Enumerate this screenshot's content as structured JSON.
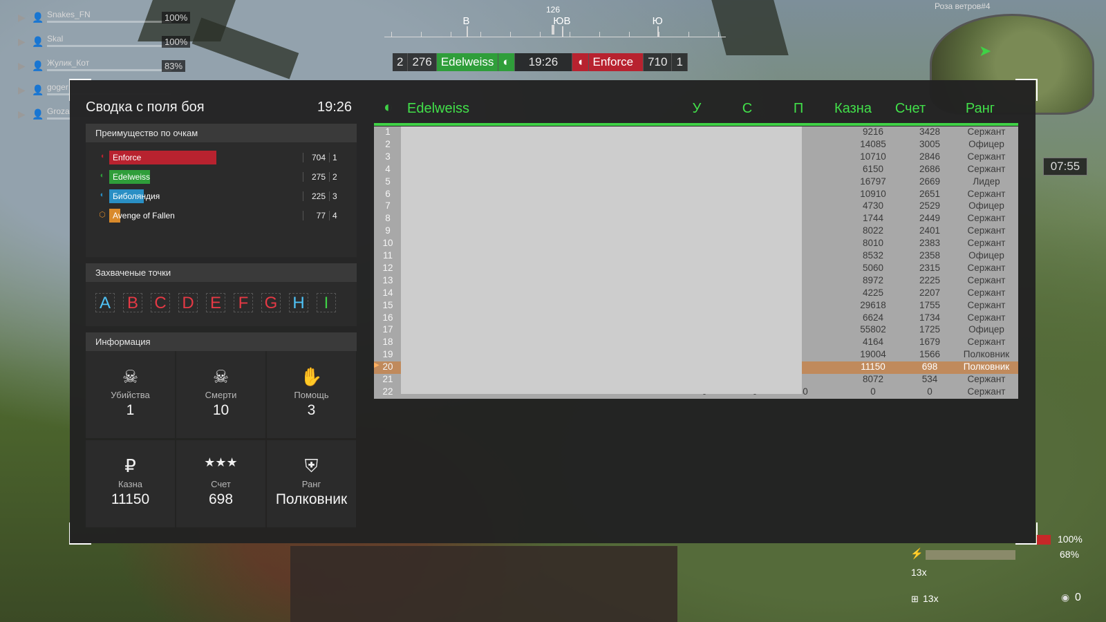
{
  "compass": {
    "heading": "126",
    "labels": [
      {
        "text": "В",
        "pos": 0.24
      },
      {
        "text": "ЮВ",
        "pos": 0.52
      },
      {
        "text": "Ю",
        "pos": 0.8
      }
    ]
  },
  "topscore": {
    "left_place": "2",
    "left_score": "276",
    "left_team": "Edelweiss",
    "time": "19:26",
    "right_team": "Enforce",
    "right_score": "710",
    "right_place": "1"
  },
  "squad": [
    {
      "name": "Snakes_FN",
      "pct": "100%"
    },
    {
      "name": "Skal",
      "pct": "100%"
    },
    {
      "name": "Жулик_Кот",
      "pct": "83%"
    },
    {
      "name": "goger",
      "pct": ""
    },
    {
      "name": "Groza",
      "pct": ""
    }
  ],
  "minimap": {
    "name": "Роза ветров#4",
    "time": "07:55"
  },
  "summary": {
    "title": "Сводка с поля боя",
    "time": "19:26",
    "advantage_header": "Преимущество по очкам",
    "advantage": [
      {
        "team": "Enforce",
        "score": "704",
        "place": "1",
        "color": "#b8222f",
        "fill": 0.5,
        "icon": "bird-icon"
      },
      {
        "team": "Edelweiss",
        "score": "275",
        "place": "2",
        "color": "#2f9e3a",
        "fill": 0.19,
        "icon": "wreath-icon"
      },
      {
        "team": "Биболяндия",
        "score": "225",
        "place": "3",
        "color": "#2a8fc4",
        "fill": 0.16,
        "icon": "wreath-icon"
      },
      {
        "team": "Avenge of Fallen",
        "score": "77",
        "place": "4",
        "color": "#d98a2b",
        "fill": 0.05,
        "icon": "shield-icon"
      }
    ],
    "points_header": "Захваченые точки",
    "points": [
      {
        "letter": "A",
        "color": "#4fc3f7"
      },
      {
        "letter": "B",
        "color": "#e53945"
      },
      {
        "letter": "C",
        "color": "#e53945"
      },
      {
        "letter": "D",
        "color": "#e53945"
      },
      {
        "letter": "E",
        "color": "#e53945"
      },
      {
        "letter": "F",
        "color": "#e53945"
      },
      {
        "letter": "G",
        "color": "#e53945"
      },
      {
        "letter": "H",
        "color": "#4fc3f7"
      },
      {
        "letter": "I",
        "color": "#3fd146"
      }
    ],
    "info_header": "Информация",
    "stats": [
      {
        "label": "Убийства",
        "value": "1",
        "icon": "skull-icon"
      },
      {
        "label": "Смерти",
        "value": "10",
        "icon": "crossbones-icon"
      },
      {
        "label": "Помощь",
        "value": "3",
        "icon": "handshake-icon"
      },
      {
        "label": "Казна",
        "value": "11150",
        "icon": "ruble-icon"
      },
      {
        "label": "Счет",
        "value": "698",
        "icon": "stars-icon"
      },
      {
        "label": "Ранг",
        "value": "Полковник",
        "icon": "rank-badge-icon"
      }
    ]
  },
  "team_table": {
    "team": "Edelweiss",
    "columns": {
      "u": "У",
      "s": "С",
      "p": "П",
      "kazna": "Казна",
      "score": "Счет",
      "rank": "Ранг"
    },
    "rows": [
      {
        "n": "1",
        "kazna": "9216",
        "score": "3428",
        "rank": "Сержант"
      },
      {
        "n": "2",
        "kazna": "14085",
        "score": "3005",
        "rank": "Офицер"
      },
      {
        "n": "3",
        "kazna": "10710",
        "score": "2846",
        "rank": "Сержант"
      },
      {
        "n": "4",
        "kazna": "6150",
        "score": "2686",
        "rank": "Сержант"
      },
      {
        "n": "5",
        "kazna": "16797",
        "score": "2669",
        "rank": "Лидер"
      },
      {
        "n": "6",
        "kazna": "10910",
        "score": "2651",
        "rank": "Сержант"
      },
      {
        "n": "7",
        "kazna": "4730",
        "score": "2529",
        "rank": "Офицер"
      },
      {
        "n": "8",
        "kazna": "1744",
        "score": "2449",
        "rank": "Сержант"
      },
      {
        "n": "9",
        "kazna": "8022",
        "score": "2401",
        "rank": "Сержант"
      },
      {
        "n": "10",
        "kazna": "8010",
        "score": "2383",
        "rank": "Сержант"
      },
      {
        "n": "11",
        "kazna": "8532",
        "score": "2358",
        "rank": "Офицер"
      },
      {
        "n": "12",
        "kazna": "5060",
        "score": "2315",
        "rank": "Сержант"
      },
      {
        "n": "13",
        "kazna": "8972",
        "score": "2225",
        "rank": "Сержант"
      },
      {
        "n": "14",
        "kazna": "4225",
        "score": "2207",
        "rank": "Сержант"
      },
      {
        "n": "15",
        "kazna": "29618",
        "score": "1755",
        "rank": "Сержант"
      },
      {
        "n": "16",
        "kazna": "6624",
        "score": "1734",
        "rank": "Сержант"
      },
      {
        "n": "17",
        "kazna": "55802",
        "score": "1725",
        "rank": "Офицер"
      },
      {
        "n": "18",
        "kazna": "4164",
        "score": "1679",
        "rank": "Сержант"
      },
      {
        "n": "19",
        "kazna": "19004",
        "score": "1566",
        "rank": "Полковник"
      },
      {
        "n": "20",
        "kazna": "11150",
        "score": "698",
        "rank": "Полковник",
        "me": true
      },
      {
        "n": "21",
        "kazna": "8072",
        "score": "534",
        "rank": "Сержант"
      },
      {
        "n": "22",
        "kazna": "0",
        "score": "0",
        "rank": "Сержант",
        "u": "0",
        "s": "0",
        "p": "0"
      }
    ]
  },
  "hud": {
    "health": "100%",
    "energy": "68%",
    "ammo_top": "13x",
    "ammo_bottom": "13x",
    "count": "0"
  }
}
